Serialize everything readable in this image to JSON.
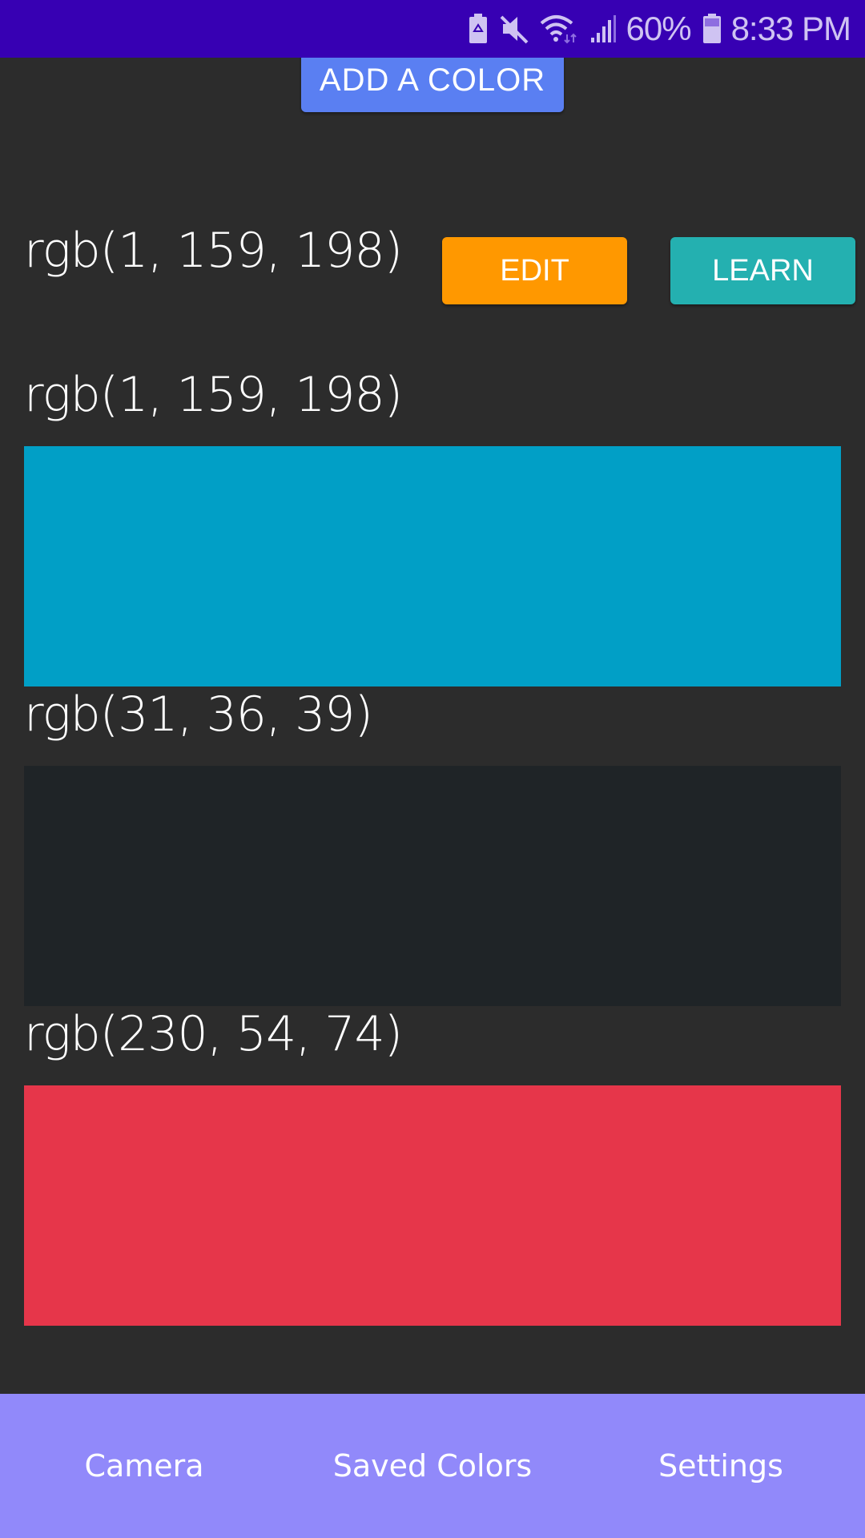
{
  "status_bar": {
    "icons": [
      "battery-saver-icon",
      "mute-icon",
      "wifi-icon",
      "signal-icon",
      "battery-icon"
    ],
    "battery_percent": "60%",
    "time": "8:33 PM"
  },
  "toolbar": {
    "add_color_label": "ADD A COLOR"
  },
  "selected": {
    "label": "rgb(1, 159, 198)",
    "edit_label": "EDIT",
    "learn_label": "LEARN"
  },
  "colors": [
    {
      "label": "rgb(1, 159, 198)",
      "hex": "#019fc6"
    },
    {
      "label": "rgb(31, 36, 39)",
      "hex": "#1f2427"
    },
    {
      "label": "rgb(230, 54, 74)",
      "hex": "#e6364a"
    }
  ],
  "theme": {
    "status_bar": "#3700b3",
    "background": "#2c2c2c",
    "add_button": "#5a7ff2",
    "edit_button": "#ff9800",
    "learn_button": "#24b0b0",
    "nav_bar": "#9189fa"
  },
  "nav": {
    "items": [
      {
        "label": "Camera"
      },
      {
        "label": "Saved Colors"
      },
      {
        "label": "Settings"
      }
    ]
  }
}
